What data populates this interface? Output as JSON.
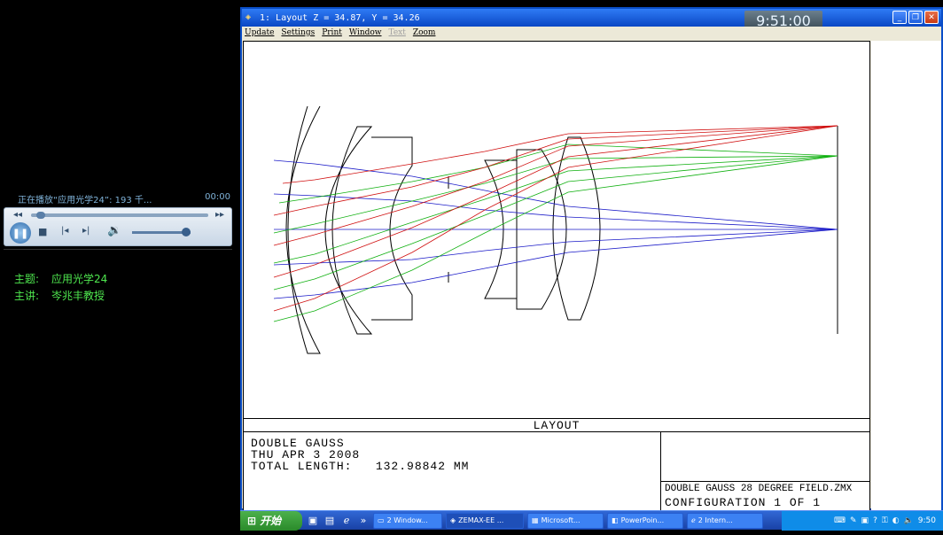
{
  "player": {
    "now_playing": "正在播放“应用光学24”: 193 千...",
    "time": "00:00",
    "icons": [
      "rewind-icon",
      "fast-forward-icon",
      "pause-icon",
      "stop-icon",
      "previous-icon",
      "next-icon",
      "volume-icon"
    ],
    "topic_label": "主题:",
    "topic_value": "应用光学24",
    "lecturer_label": "主讲:",
    "lecturer_value": "岑兆丰教授"
  },
  "window": {
    "title": "1: Layout  Z = 34.87, Y = 34.26",
    "clock": "9:51:00",
    "menu": [
      "Update",
      "Settings",
      "Print",
      "Window",
      "Text",
      "Zoom"
    ],
    "menu_disabled": [
      false,
      false,
      false,
      false,
      true,
      false
    ]
  },
  "layout": {
    "label": "LAYOUT",
    "line1": "DOUBLE GAUSS",
    "line2": "THU APR 3 2008",
    "line3": "TOTAL LENGTH:   132.98842 MM",
    "file": "DOUBLE GAUSS 28 DEGREE FIELD.ZMX",
    "config": "CONFIGURATION  1  OF  1",
    "ray_colors": {
      "field1": "#1a1ac8",
      "field2": "#10b010",
      "field3": "#d01010"
    }
  },
  "taskbar": {
    "start": "开始",
    "tasks": [
      "2 Window...",
      "ZEMAX-EE ...",
      "Microsoft...",
      "PowerPoin...",
      "2 Intern..."
    ],
    "time": "9:50"
  }
}
